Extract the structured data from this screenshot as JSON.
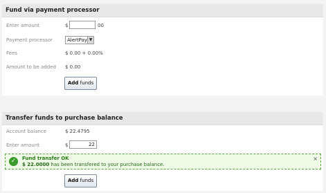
{
  "fund_panel": {
    "title": "Fund via payment processor",
    "enter_amount_label": "Enter amount",
    "currency_symbol": "$",
    "amount_value": "",
    "cents_suffix": "00",
    "processor_label": "Payment processor",
    "processor_selected": "AlertPay",
    "fees_label": "Fees",
    "fees_value": "$ 0.00 + 0.00%",
    "amount_added_label": "Amount to be added",
    "amount_added_value": "$ 0.00",
    "add_funds_bold": "Add",
    "add_funds_rest": " funds"
  },
  "transfer_panel": {
    "title": "Transfer funds to purchase balance",
    "account_balance_label": "Account balance",
    "account_balance_value": "$ 22.4795",
    "enter_amount_label": "Enter amount",
    "currency_symbol": "$",
    "amount_value": "22",
    "alert": {
      "title": "Fund transfer OK",
      "amount": "$ 22.0000",
      "message": " has been transfered to your purchase balance.",
      "close_glyph": "×",
      "icon": "check-icon",
      "color": "#3a9a2a"
    },
    "add_funds_bold": "Add",
    "add_funds_rest": " funds"
  }
}
